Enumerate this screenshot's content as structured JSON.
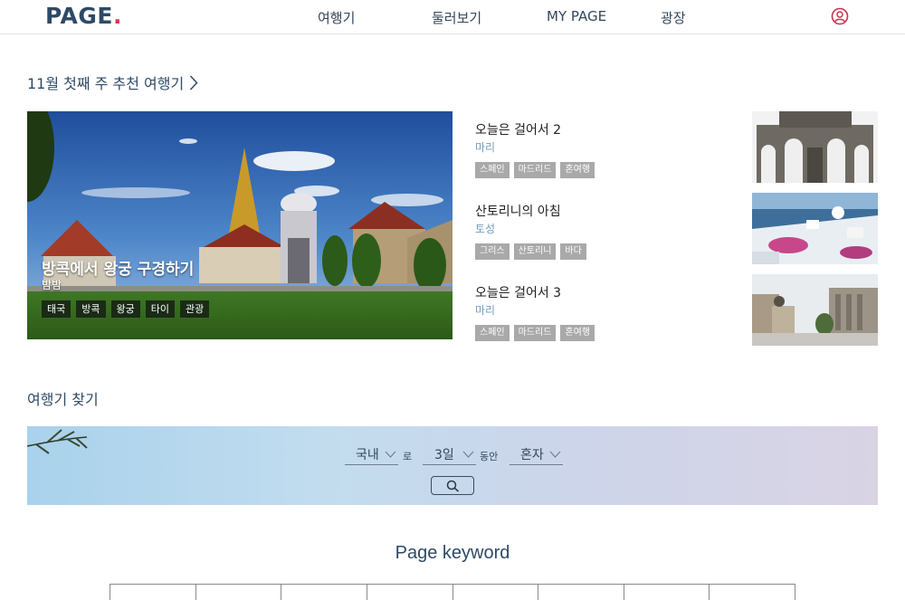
{
  "header": {
    "logo": "PAGE",
    "logo_dot": ".",
    "nav": [
      "여행기",
      "둘러보기",
      "MY PAGE",
      "광장"
    ],
    "user_icon": "user-circle-icon"
  },
  "recommend": {
    "title": "11월 첫째 주 추천 여행기",
    "featured": {
      "title": "방콕에서 왕궁 구경하기",
      "author": "밤밤",
      "tags": [
        "태국",
        "방콕",
        "왕궁",
        "타이",
        "관광"
      ]
    },
    "items": [
      {
        "title": "오늘은 걸어서 2",
        "author": "마리",
        "tags": [
          "스페인",
          "마드리드",
          "혼여행"
        ]
      },
      {
        "title": "산토리니의 아침",
        "author": "토성",
        "tags": [
          "그리스",
          "산토리니",
          "바다"
        ]
      },
      {
        "title": "오늘은 걸어서 3",
        "author": "마리",
        "tags": [
          "스페인",
          "마드리드",
          "혼여행"
        ]
      }
    ]
  },
  "find": {
    "title": "여행기 찾기",
    "region": "국내",
    "joiner1": "로",
    "duration": "3일",
    "joiner2": "동안",
    "companion": "혼자",
    "search_icon": "search-icon"
  },
  "keyword": {
    "title": "Page keyword",
    "cells": 8
  },
  "colors": {
    "brand": "#2e4a66",
    "logo_dot": "#e2344a",
    "author": "#7a9cba",
    "tag_gray": "#a9a9a9"
  }
}
